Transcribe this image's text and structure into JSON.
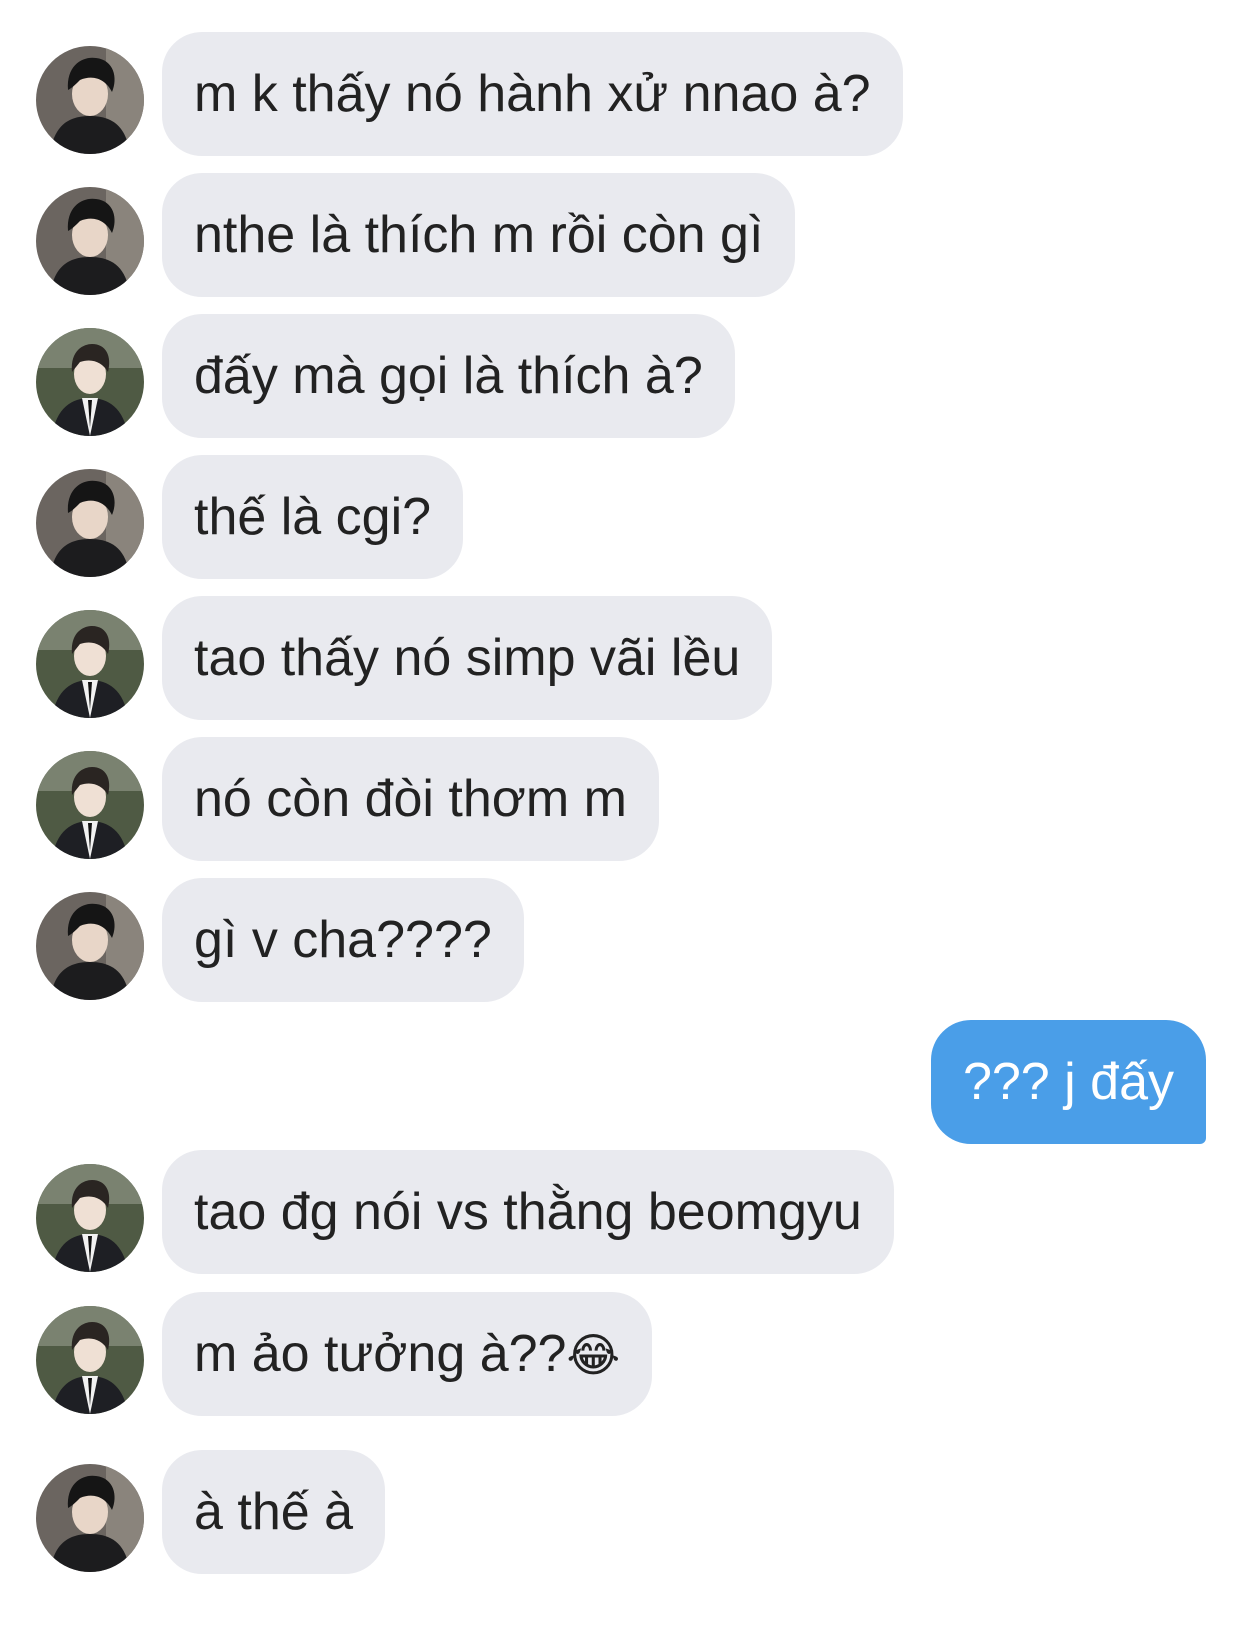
{
  "messages": [
    {
      "direction": "in",
      "sender": "a",
      "text": "m k thấy nó hành xử nnao à?"
    },
    {
      "direction": "in",
      "sender": "a",
      "text": "nthe là thích m rồi còn gì"
    },
    {
      "direction": "in",
      "sender": "b",
      "text": "đấy mà gọi là thích à?"
    },
    {
      "direction": "in",
      "sender": "a",
      "text": "thế là cgi?"
    },
    {
      "direction": "in",
      "sender": "b",
      "text": "tao thấy nó simp vãi lều"
    },
    {
      "direction": "in",
      "sender": "b",
      "text": "nó còn đòi thơm m"
    },
    {
      "direction": "in",
      "sender": "a",
      "text": "gì v cha????"
    },
    {
      "direction": "out",
      "sender": "me",
      "text": "??? j đấy"
    },
    {
      "direction": "in",
      "sender": "b",
      "text": "tao đg nói vs thằng beomgyu"
    },
    {
      "direction": "in",
      "sender": "b",
      "text": "m ảo tưởng à??",
      "emoji": "😂"
    },
    {
      "direction": "in",
      "sender": "a",
      "text": "à thế à"
    }
  ],
  "colors": {
    "incoming_bubble": "#e9eaef",
    "outgoing_bubble": "#4a9ee8",
    "incoming_text": "#222222",
    "outgoing_text": "#ffffff"
  },
  "icons": {
    "avatar_a": "avatar-dark-hair-black-jacket",
    "avatar_b": "avatar-suit-tie-outdoor",
    "emoji": "face-with-tears-of-joy"
  }
}
